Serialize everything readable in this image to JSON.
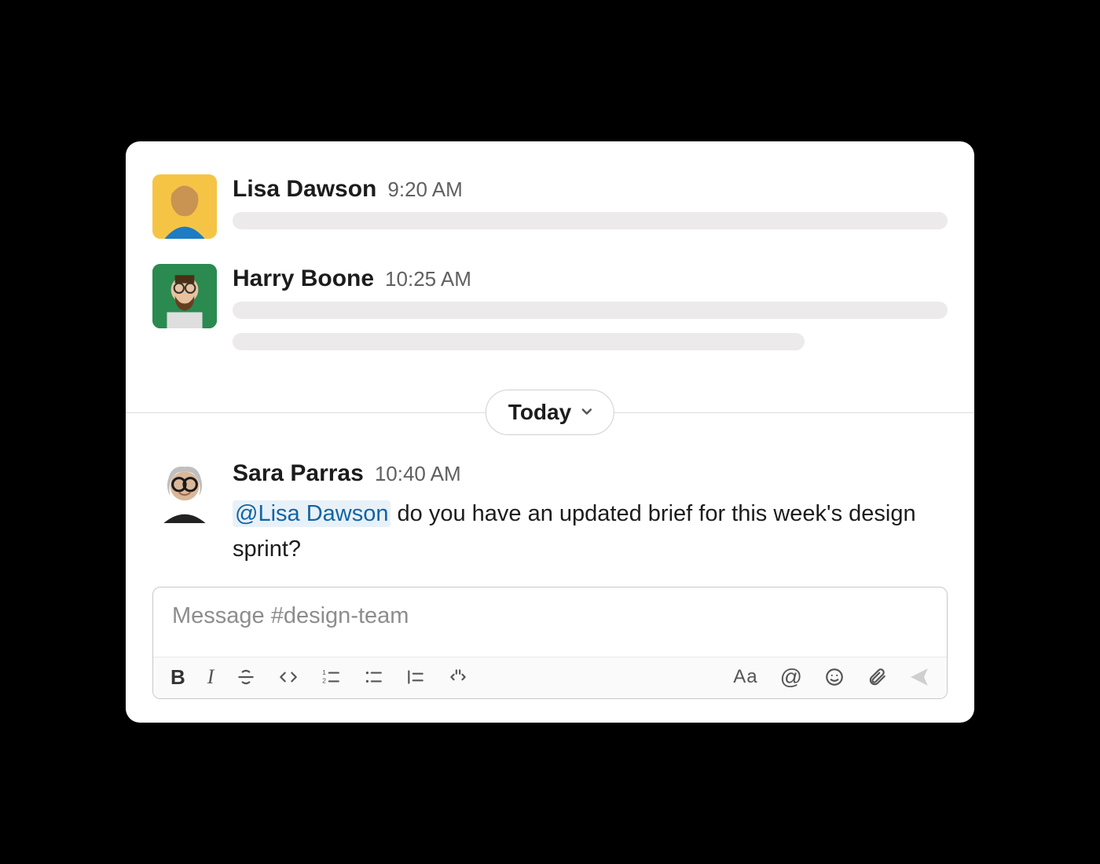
{
  "messages": [
    {
      "author": "Lisa Dawson",
      "time": "9:20 AM",
      "avatar_bg": "#f6c445",
      "placeholder_lines": 1
    },
    {
      "author": "Harry Boone",
      "time": "10:25 AM",
      "avatar_bg": "#2a8a50",
      "placeholder_lines": 2
    }
  ],
  "divider_label": "Today",
  "featured_message": {
    "author": "Sara Parras",
    "time": "10:40 AM",
    "avatar_bg": "#ffffff",
    "mention": "@Lisa Dawson",
    "text_after_mention": " do you have an updated brief for this week's design sprint?"
  },
  "composer": {
    "placeholder": "Message #design-team"
  },
  "toolbar_left": [
    "bold",
    "italic",
    "strike",
    "code",
    "ordered-list",
    "bullet-list",
    "quote",
    "code-block"
  ],
  "toolbar_right": [
    "text-style",
    "mention",
    "emoji",
    "attach",
    "send"
  ]
}
